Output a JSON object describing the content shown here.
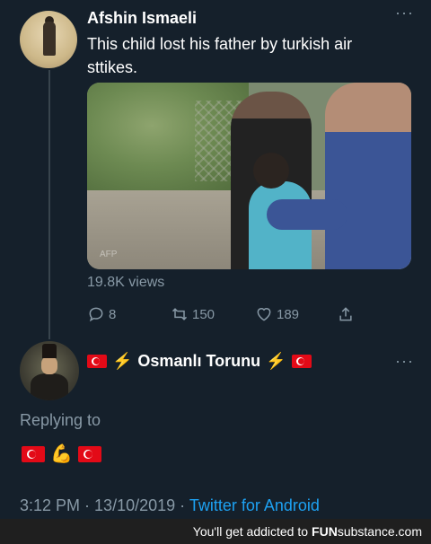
{
  "tweet": {
    "author": "Afshin Ismaeli",
    "text": "This child lost his father by turkish air sttikes.",
    "more_label": "···",
    "views": "19.8K views",
    "replies": "8",
    "retweets": "150",
    "likes": "189",
    "watermark": "AFP"
  },
  "reply": {
    "author": "Osmanlı Torunu",
    "more_label": "···",
    "replying_to": "Replying to",
    "time": "3:12 PM",
    "separator1": " · ",
    "date": "13/10/2019",
    "separator2": " · ",
    "source": "Twitter for Android"
  },
  "footer": {
    "text": "You'll get addicted to",
    "brand_main": "FUN",
    "brand_sub": "substance.com"
  },
  "icons": [
    "reply-icon",
    "retweet-icon",
    "like-icon",
    "share-icon",
    "turkey-flag-icon",
    "lightning-icon",
    "flexed-biceps-icon"
  ],
  "colors": {
    "background": "#15202b",
    "muted": "#8899a6",
    "link": "#1da1f2",
    "flag_red": "#e30a17"
  }
}
